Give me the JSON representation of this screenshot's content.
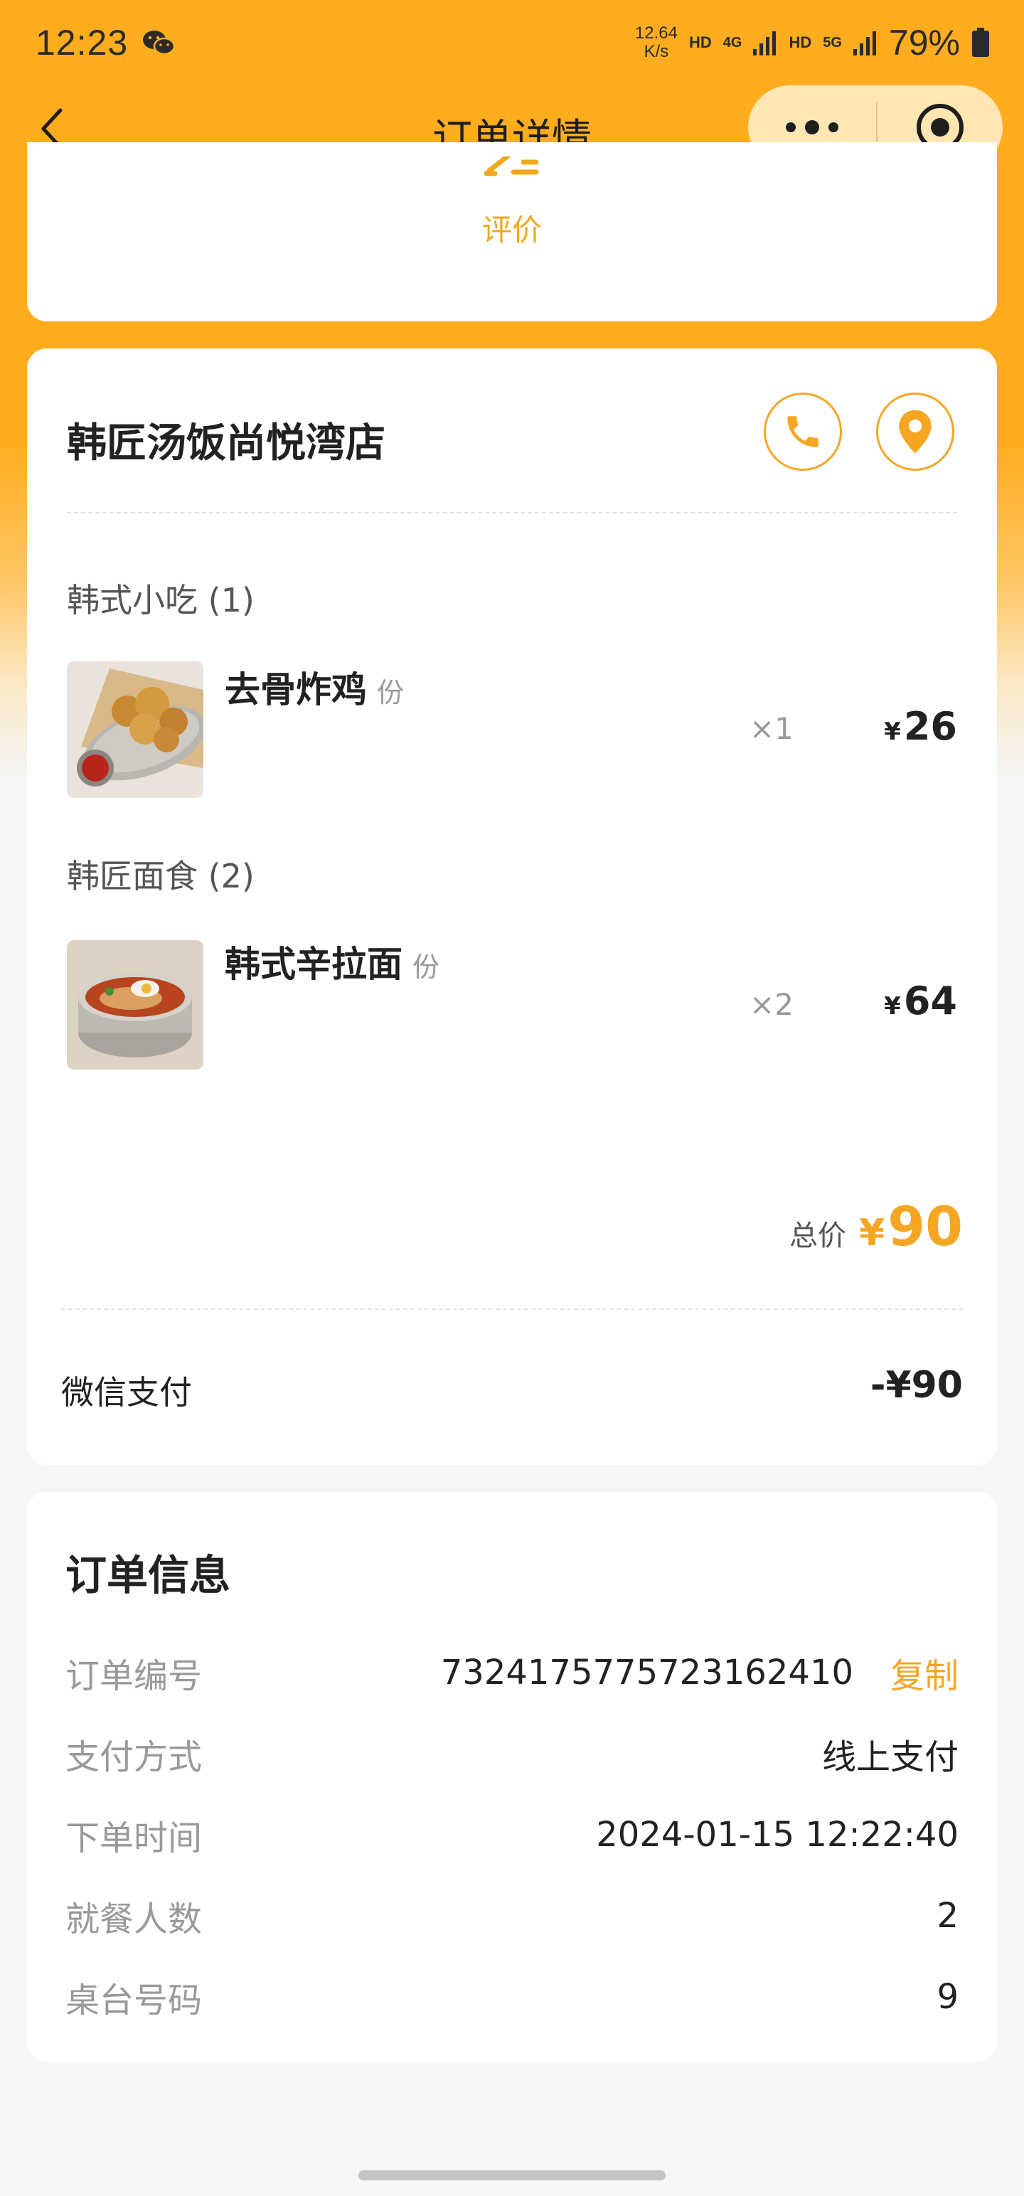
{
  "colors": {
    "header_bg": "#ffad1f",
    "accent": "#f5a623",
    "page_bg": "#f5f6f8"
  },
  "status_bar": {
    "time": "12:23",
    "speed_value": "12.64",
    "speed_unit": "K/s",
    "hd1": "HD",
    "net1": "4G",
    "hd2": "HD",
    "net2": "5G",
    "battery": "79%"
  },
  "navbar": {
    "title": "订单详情"
  },
  "review": {
    "label": "评价"
  },
  "store": {
    "name": "韩匠汤饭尚悦湾店"
  },
  "categories": [
    {
      "name": "韩式小吃 (1)",
      "dishes": [
        {
          "name": "去骨炸鸡",
          "unit": "份",
          "qty": "×1",
          "currency": "¥",
          "price": "26"
        }
      ]
    },
    {
      "name": "韩匠面食 (2)",
      "dishes": [
        {
          "name": "韩式辛拉面",
          "unit": "份",
          "qty": "×2",
          "currency": "¥",
          "price": "64"
        }
      ]
    }
  ],
  "total": {
    "label": "总价",
    "currency": "¥",
    "value": "90"
  },
  "payment": {
    "method": "微信支付",
    "amount": "-¥90"
  },
  "order_info": {
    "title": "订单信息",
    "rows": [
      {
        "key": "订单编号",
        "value": "7324175775723162410",
        "action": "复制"
      },
      {
        "key": "支付方式",
        "value": "线上支付"
      },
      {
        "key": "下单时间",
        "value": "2024-01-15 12:22:40"
      },
      {
        "key": "就餐人数",
        "value": "2"
      },
      {
        "key": "桌台号码",
        "value": "9"
      }
    ]
  }
}
